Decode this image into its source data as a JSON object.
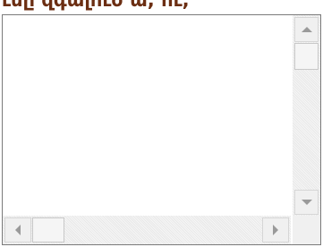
{
  "heading": {
    "text": "ւնը զգալուծ ա, ու,"
  },
  "listbox": {
    "items": []
  },
  "scrollbars": {
    "up_icon": "arrow-up",
    "down_icon": "arrow-down",
    "left_icon": "arrow-left",
    "right_icon": "arrow-right"
  },
  "colors": {
    "heading": "#6b2e12",
    "border": "#7a7a7a",
    "arrow": "#9a9a9a"
  }
}
